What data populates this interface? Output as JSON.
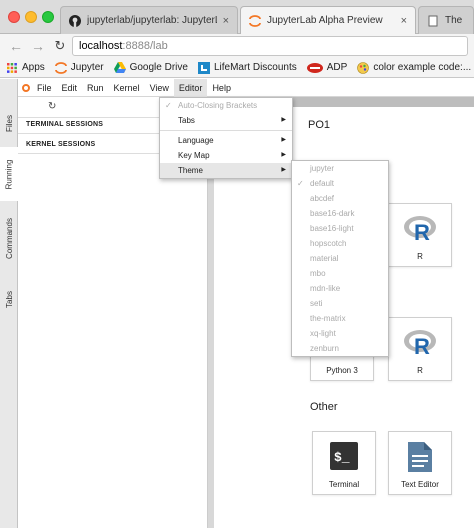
{
  "browser": {
    "tabs": [
      {
        "label": "jupyterlab/jupyterlab: JupyterL",
        "state": "inactive",
        "icon": "github-icon"
      },
      {
        "label": "JupyterLab Alpha Preview",
        "state": "active",
        "icon": "jupyter-icon"
      },
      {
        "label": "The Un",
        "state": "inactive",
        "icon": "page-icon"
      }
    ],
    "close_glyph": "×",
    "url_host": "localhost",
    "url_rest": ":8888/lab",
    "bookmarks": [
      {
        "label": "Apps",
        "icon": "apps-grid-icon"
      },
      {
        "label": "Jupyter",
        "icon": "jupyter-icon"
      },
      {
        "label": "Google Drive",
        "icon": "google-drive-icon"
      },
      {
        "label": "LifeMart Discounts",
        "icon": "lifemart-icon"
      },
      {
        "label": "ADP",
        "icon": "adp-icon"
      },
      {
        "label": "color example code:...",
        "icon": "color-example-icon"
      }
    ]
  },
  "jupyterlab": {
    "side_tabs": [
      "Files",
      "Running",
      "Commands",
      "Tabs"
    ],
    "menu": [
      "File",
      "Edit",
      "Run",
      "Kernel",
      "View",
      "Editor",
      "Help"
    ],
    "sidebar": {
      "terminal_sessions": "TERMINAL SESSIONS",
      "kernel_sessions": "KERNEL SESSIONS"
    },
    "launcher": {
      "po1_heading": "PO1",
      "other_heading": "Other",
      "cards": {
        "r_top": "R",
        "python3": "Python 3",
        "r_bottom": "R",
        "terminal": "Terminal",
        "text_editor": "Text Editor"
      }
    },
    "editor_menu": {
      "items": [
        {
          "label": "Auto-Closing Brackets",
          "disabled": true,
          "checked": true,
          "submenu": false
        },
        {
          "label": "Tabs",
          "disabled": false,
          "checked": false,
          "submenu": true
        },
        {
          "label": "Language",
          "disabled": false,
          "checked": false,
          "submenu": true
        },
        {
          "label": "Key Map",
          "disabled": false,
          "checked": false,
          "submenu": true
        },
        {
          "label": "Theme",
          "disabled": false,
          "checked": false,
          "submenu": true,
          "highlighted": true
        }
      ],
      "check_glyph": "✓",
      "arrow_glyph": "▶"
    },
    "theme_menu": {
      "items": [
        "jupyter",
        "default",
        "abcdef",
        "base16-dark",
        "base16-light",
        "hopscotch",
        "material",
        "mbo",
        "mdn-like",
        "seti",
        "the-matrix",
        "xq-light",
        "zenburn"
      ],
      "selected": "default"
    }
  },
  "colors": {
    "jupyter_orange": "#f37726",
    "r_blue": "#2166ac",
    "active_tab_bg": "#f4f4f4"
  }
}
